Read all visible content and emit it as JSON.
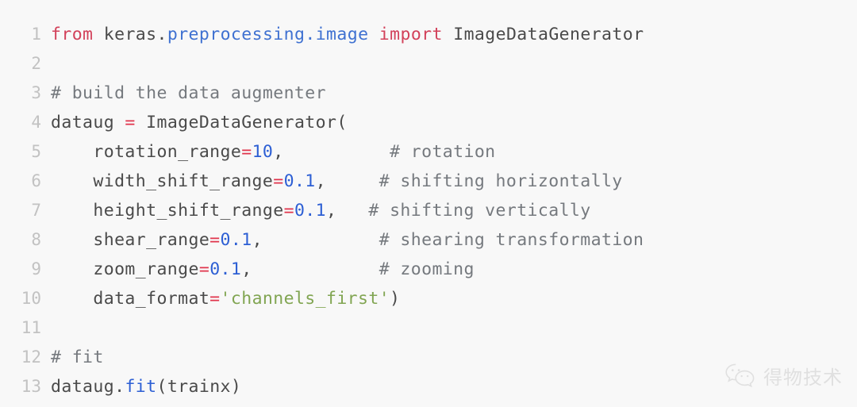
{
  "editor": {
    "background_color": "#f8f8f8",
    "gutter_color": "#c2c2c2",
    "default_text_color": "#4a4a4a",
    "language": "python",
    "lines": [
      {
        "number": "1",
        "tokens": [
          {
            "t": "from",
            "c": "kw"
          },
          {
            "t": " ",
            "c": "punct"
          },
          {
            "t": "keras",
            "c": "name"
          },
          {
            "t": ".",
            "c": "punct"
          },
          {
            "t": "preprocessing",
            "c": "module"
          },
          {
            "t": ".",
            "c": "module"
          },
          {
            "t": "image",
            "c": "module"
          },
          {
            "t": " ",
            "c": "punct"
          },
          {
            "t": "import",
            "c": "kw"
          },
          {
            "t": " ",
            "c": "punct"
          },
          {
            "t": "ImageDataGenerator",
            "c": "name"
          }
        ]
      },
      {
        "number": "2",
        "tokens": []
      },
      {
        "number": "3",
        "tokens": [
          {
            "t": "# build the data augmenter",
            "c": "comment"
          }
        ]
      },
      {
        "number": "4",
        "tokens": [
          {
            "t": "dataug ",
            "c": "name"
          },
          {
            "t": "=",
            "c": "op"
          },
          {
            "t": " ImageDataGenerator(",
            "c": "name"
          }
        ]
      },
      {
        "number": "5",
        "tokens": [
          {
            "t": "    rotation_range",
            "c": "name"
          },
          {
            "t": "=",
            "c": "op"
          },
          {
            "t": "10",
            "c": "num"
          },
          {
            "t": ",          ",
            "c": "punct"
          },
          {
            "t": "# rotation",
            "c": "comment"
          }
        ]
      },
      {
        "number": "6",
        "tokens": [
          {
            "t": "    width_shift_range",
            "c": "name"
          },
          {
            "t": "=",
            "c": "op"
          },
          {
            "t": "0.1",
            "c": "num"
          },
          {
            "t": ",     ",
            "c": "punct"
          },
          {
            "t": "# shifting horizontally",
            "c": "comment"
          }
        ]
      },
      {
        "number": "7",
        "tokens": [
          {
            "t": "    height_shift_range",
            "c": "name"
          },
          {
            "t": "=",
            "c": "op"
          },
          {
            "t": "0.1",
            "c": "num"
          },
          {
            "t": ",   ",
            "c": "punct"
          },
          {
            "t": "# shifting vertically",
            "c": "comment"
          }
        ]
      },
      {
        "number": "8",
        "tokens": [
          {
            "t": "    shear_range",
            "c": "name"
          },
          {
            "t": "=",
            "c": "op"
          },
          {
            "t": "0.1",
            "c": "num"
          },
          {
            "t": ",           ",
            "c": "punct"
          },
          {
            "t": "# shearing transformation",
            "c": "comment"
          }
        ]
      },
      {
        "number": "9",
        "tokens": [
          {
            "t": "    zoom_range",
            "c": "name"
          },
          {
            "t": "=",
            "c": "op"
          },
          {
            "t": "0.1",
            "c": "num"
          },
          {
            "t": ",            ",
            "c": "punct"
          },
          {
            "t": "# zooming",
            "c": "comment"
          }
        ]
      },
      {
        "number": "10",
        "tokens": [
          {
            "t": "    data_format",
            "c": "name"
          },
          {
            "t": "=",
            "c": "op"
          },
          {
            "t": "'channels_first'",
            "c": "str"
          },
          {
            "t": ")",
            "c": "punct"
          }
        ]
      },
      {
        "number": "11",
        "tokens": []
      },
      {
        "number": "12",
        "tokens": [
          {
            "t": "# fit",
            "c": "comment"
          }
        ]
      },
      {
        "number": "13",
        "tokens": [
          {
            "t": "dataug",
            "c": "name"
          },
          {
            "t": ".",
            "c": "punct"
          },
          {
            "t": "fit",
            "c": "fn"
          },
          {
            "t": "(trainx)",
            "c": "punct"
          }
        ]
      }
    ]
  },
  "watermark": {
    "label": "得物技术",
    "icon": "wechat-icon",
    "color": "#dedede"
  }
}
